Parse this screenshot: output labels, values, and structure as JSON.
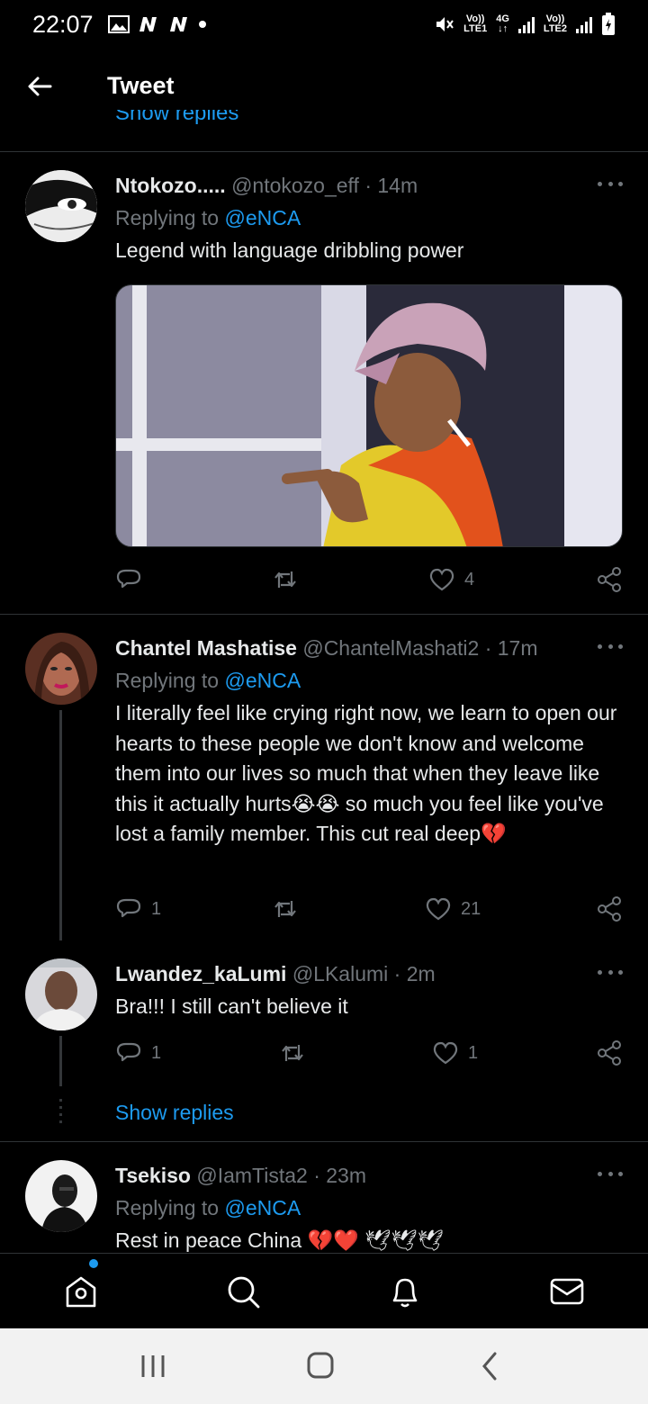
{
  "status_bar": {
    "time": "22:07",
    "net1_top": "Vo))",
    "net1_bottom": "LTE1",
    "net_type": "4G",
    "net2_top": "Vo))",
    "net2_bottom": "LTE2"
  },
  "header": {
    "title": "Tweet",
    "back_icon": "arrow-left-icon"
  },
  "top_show_replies": "Show replies",
  "tweets": [
    {
      "name": "Ntokozo.....",
      "handle": "@ntokozo_eff",
      "time": "· 14m",
      "replying_label": "Replying to",
      "replying_to": "@eNCA",
      "text": "Legend with language dribbling power",
      "replies": "",
      "retweets": "",
      "likes": "4"
    },
    {
      "name": "Chantel Mashatise",
      "handle": "@ChantelMashati2",
      "time": "· 17m",
      "replying_label": "Replying to",
      "replying_to": "@eNCA",
      "text": "I literally feel like crying right now, we learn to open our hearts to these people we don't know and welcome them into our lives so much that when they leave like this it actually hurts😭😭 so much you feel like you've lost a family member. This cut real deep💔",
      "replies": "1",
      "retweets": "",
      "likes": "21"
    },
    {
      "name": "Lwandez_kaLumi",
      "handle": "@LKalumi",
      "time": "· 2m",
      "text": "Bra!!! I still can't believe it",
      "replies": "1",
      "retweets": "",
      "likes": "1",
      "show_replies": "Show replies"
    },
    {
      "name": "Tsekiso",
      "handle": "@IamTista2",
      "time": "· 23m",
      "replying_label": "Replying to",
      "replying_to": "@eNCA",
      "text": "Rest in peace China 💔❤️ 🕊🕊🕊"
    }
  ],
  "bottom_nav": [
    "home-icon",
    "search-icon",
    "notifications-icon",
    "messages-icon"
  ],
  "system_nav": [
    "recents-icon",
    "home-button-icon",
    "back-icon"
  ]
}
